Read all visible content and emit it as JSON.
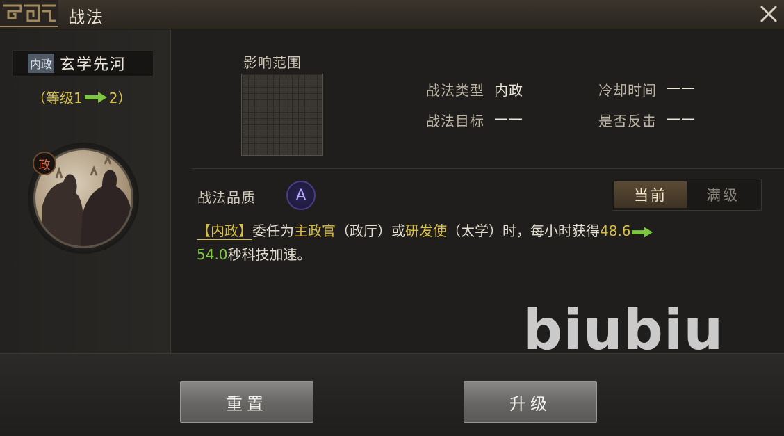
{
  "window": {
    "title": "战法"
  },
  "skill": {
    "type_tag": "内政",
    "name": "玄学先河",
    "level_open": "（等级1",
    "level_close": "2）",
    "badge": "政"
  },
  "range": {
    "label": "影响范围"
  },
  "info": {
    "type_label": "战法类型",
    "type_value": "内政",
    "cooldown_label": "冷却时间",
    "cooldown_value": "——",
    "target_label": "战法目标",
    "target_value": "——",
    "counter_label": "是否反击",
    "counter_value": "——"
  },
  "quality": {
    "label": "战法品质",
    "grade": "A"
  },
  "toggle": {
    "current": "当前",
    "max": "满级"
  },
  "description": {
    "tag": "【内政】",
    "p1": "委任为",
    "role1": "主政官",
    "p2": "（政厅）或",
    "role2": "研发使",
    "p3": "（太学）时，每小时获得",
    "num_old": "48.6",
    "num_new": "54.0",
    "p4": "秒科技加速。"
  },
  "watermark": "biubiu",
  "buttons": {
    "reset": "重置",
    "upgrade": "升级"
  },
  "colors": {
    "accent_yellow": "#d8c048",
    "accent_green": "#7cc83e",
    "quality_purple": "#4c3c86"
  },
  "icons": [
    "title-ornament-icon",
    "close-icon",
    "arrow-right-icon"
  ]
}
